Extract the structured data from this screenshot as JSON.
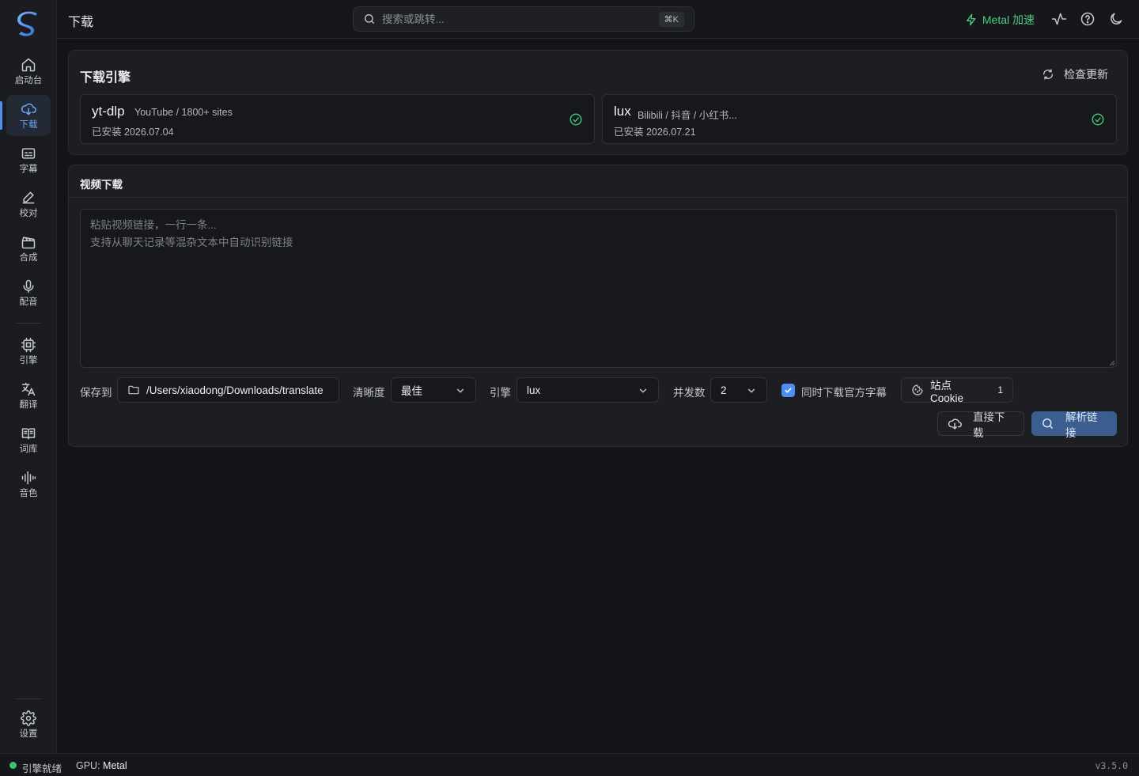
{
  "app": {
    "logo_letter": "S",
    "accent": "#4d8ef0",
    "success": "#3fbf73"
  },
  "sidebar": {
    "items": [
      {
        "label": "启动台",
        "icon": "home-icon"
      },
      {
        "label": "下载",
        "icon": "cloud-download-icon",
        "active": true
      },
      {
        "label": "字幕",
        "icon": "subtitles-icon"
      },
      {
        "label": "校对",
        "icon": "pen-icon"
      },
      {
        "label": "合成",
        "icon": "clapperboard-icon"
      },
      {
        "label": "配音",
        "icon": "mic-icon"
      },
      {
        "label": "引擎",
        "icon": "cpu-icon"
      },
      {
        "label": "翻译",
        "icon": "translate-icon"
      },
      {
        "label": "词库",
        "icon": "book-icon"
      },
      {
        "label": "音色",
        "icon": "waveform-icon"
      },
      {
        "label": "设置",
        "icon": "gear-icon"
      }
    ]
  },
  "topbar": {
    "title": "下载",
    "search_placeholder": "搜索或跳转...",
    "search_shortcut": "⌘K",
    "metal_label": "Metal 加速"
  },
  "engines_panel": {
    "title": "下载引擎",
    "check_update_label": "检查更新",
    "engines": [
      {
        "name": "yt-dlp",
        "desc": "YouTube / 1800+ sites",
        "installed": "已安装 2026.07.04",
        "status": "ok"
      },
      {
        "name": "lux",
        "desc": "Bilibili / 抖音 / 小红书...",
        "installed": "已安装 2026.07.21",
        "status": "ok"
      }
    ]
  },
  "video_panel": {
    "title": "视频下载",
    "urls_placeholder": "粘贴视频链接，一行一条...\n支持从聊天记录等混杂文本中自动识别链接",
    "urls_value": "",
    "save_to_label": "保存到",
    "save_path": "/Users/xiaodong/Downloads/translate",
    "quality_label": "清晰度",
    "quality_value": "最佳",
    "engine_label": "引擎",
    "engine_value": "lux",
    "concurrency_label": "并发数",
    "concurrency_value": "2",
    "subtitle_checkbox_label": "同时下载官方字幕",
    "subtitle_checked": true,
    "cookie_label": "站点 Cookie",
    "cookie_count": "1",
    "direct_download_label": "直接下载",
    "parse_label": "解析链接"
  },
  "statusbar": {
    "engine_status": "引擎就绪",
    "gpu_label": "GPU:",
    "gpu_value": "Metal",
    "version": "v3.5.0"
  }
}
